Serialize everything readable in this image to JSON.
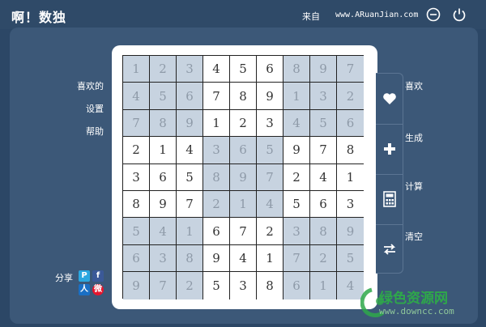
{
  "window": {
    "title": "啊！数独",
    "source_label": "来自",
    "source_url": "www.ARuanJian.com"
  },
  "left_menu": [
    {
      "label": "喜欢的"
    },
    {
      "label": "设置"
    },
    {
      "label": "帮助"
    }
  ],
  "share": {
    "label": "分享",
    "icons": [
      "pengyou-icon",
      "facebook-icon",
      "renren-icon",
      "weibo-icon"
    ]
  },
  "toolbar": [
    {
      "label": "喜欢",
      "icon": "heart-icon"
    },
    {
      "label": "生成",
      "icon": "plus-icon"
    },
    {
      "label": "计算",
      "icon": "calculator-icon"
    },
    {
      "label": "清空",
      "icon": "swap-arrows-icon"
    }
  ],
  "board": {
    "rows": [
      [
        "1",
        "2",
        "3",
        "4",
        "5",
        "6",
        "8",
        "9",
        "7"
      ],
      [
        "4",
        "5",
        "6",
        "7",
        "8",
        "9",
        "1",
        "3",
        "2"
      ],
      [
        "7",
        "8",
        "9",
        "1",
        "2",
        "3",
        "4",
        "5",
        "6"
      ],
      [
        "2",
        "1",
        "4",
        "3",
        "6",
        "5",
        "9",
        "7",
        "8"
      ],
      [
        "3",
        "6",
        "5",
        "8",
        "9",
        "7",
        "2",
        "4",
        "1"
      ],
      [
        "8",
        "9",
        "7",
        "2",
        "1",
        "4",
        "5",
        "6",
        "3"
      ],
      [
        "5",
        "4",
        "1",
        "6",
        "7",
        "2",
        "3",
        "8",
        "9"
      ],
      [
        "6",
        "3",
        "8",
        "9",
        "4",
        "1",
        "7",
        "2",
        "5"
      ],
      [
        "9",
        "7",
        "2",
        "5",
        "3",
        "8",
        "6",
        "1",
        "4"
      ]
    ]
  },
  "watermark": {
    "text": "绿色资源网",
    "url": "www.downcc.com"
  },
  "colors": {
    "background": "#2c4766",
    "panel": "#3c5878",
    "shaded_cell": "#c7d3e0",
    "watermark_green": "#2ea84a"
  }
}
